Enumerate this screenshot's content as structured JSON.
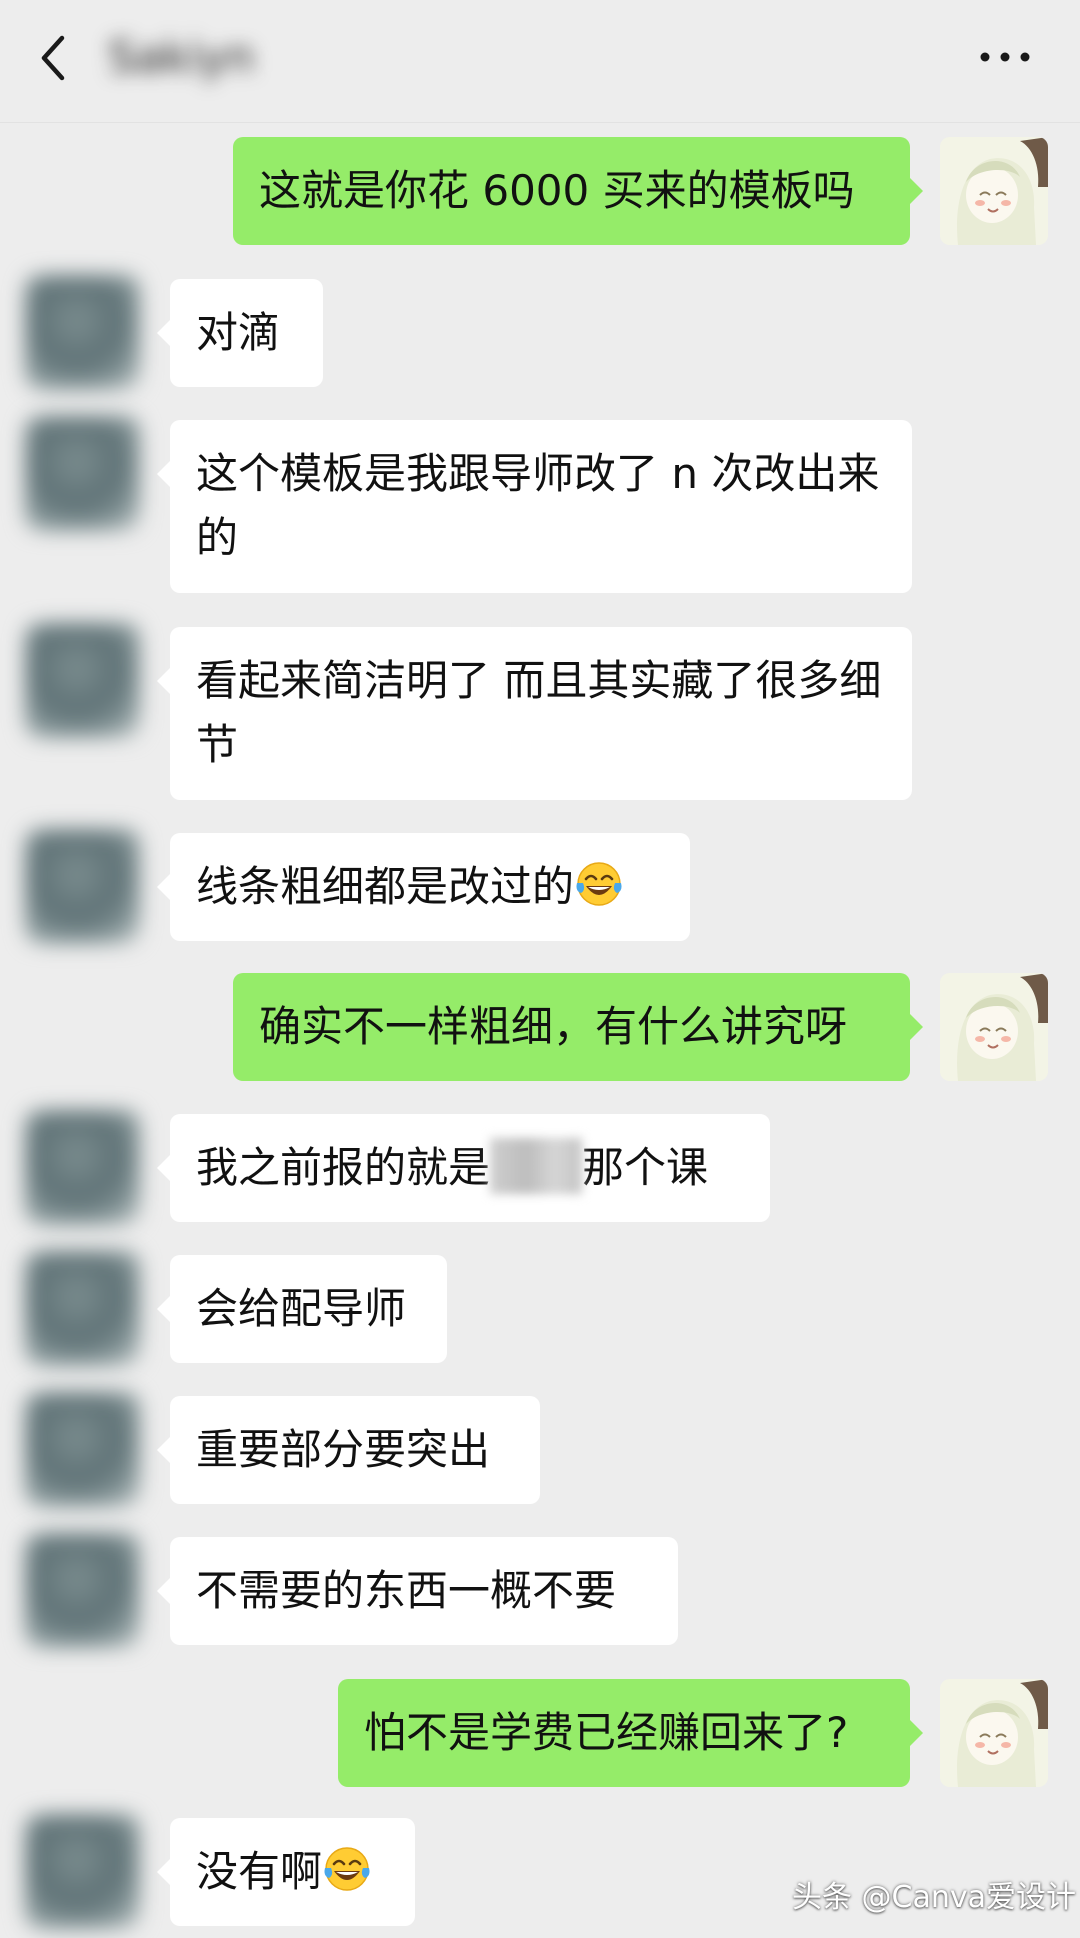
{
  "header": {
    "contact_name": "Sakiyn",
    "back_icon": "chevron-left-icon",
    "more_icon": "ellipsis-icon"
  },
  "messages": [
    {
      "side": "right",
      "text": "这就是你花 6000 买来的模板吗"
    },
    {
      "side": "left",
      "text": "对滴"
    },
    {
      "side": "left",
      "text": "这个模板是我跟导师改了 n 次改出来的"
    },
    {
      "side": "left",
      "text": "看起来简洁明了 而且其实藏了很多细节"
    },
    {
      "side": "left",
      "text": "线条粗细都是改过的",
      "emoji": "tears-of-joy-emoji"
    },
    {
      "side": "right",
      "text": "确实不一样粗细，有什么讲究呀"
    },
    {
      "side": "left",
      "text_before": "我之前报的就是",
      "text_after": "那个课"
    },
    {
      "side": "left",
      "text": "会给配导师"
    },
    {
      "side": "left",
      "text": "重要部分要突出"
    },
    {
      "side": "left",
      "text": "不需要的东西一概不要"
    },
    {
      "side": "right",
      "text": "怕不是学费已经赚回来了?"
    },
    {
      "side": "left",
      "text": "没有啊",
      "emoji": "tears-of-joy-emoji"
    }
  ],
  "watermark": "头条 @Canva爱设计",
  "colors": {
    "background": "#ededed",
    "sent_bubble": "#95ec69",
    "received_bubble": "#ffffff"
  }
}
